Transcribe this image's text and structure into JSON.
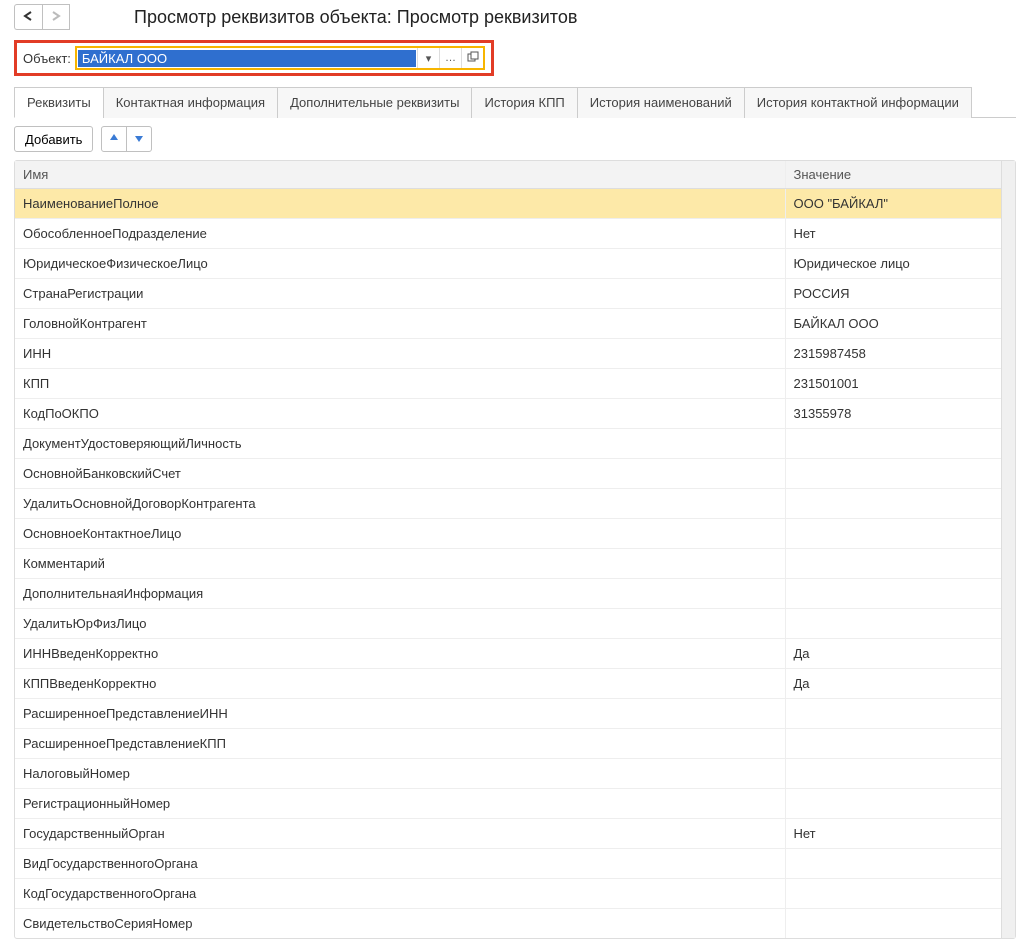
{
  "header": {
    "title": "Просмотр реквизитов объекта: Просмотр реквизитов"
  },
  "object_row": {
    "label": "Объект:",
    "value": "БАЙКАЛ ООО"
  },
  "tabs": [
    {
      "label": "Реквизиты",
      "active": true
    },
    {
      "label": "Контактная информация",
      "active": false
    },
    {
      "label": "Дополнительные реквизиты",
      "active": false
    },
    {
      "label": "История КПП",
      "active": false
    },
    {
      "label": "История наименований",
      "active": false
    },
    {
      "label": "История контактной информации",
      "active": false
    }
  ],
  "toolbar": {
    "add_label": "Добавить"
  },
  "table": {
    "headers": {
      "name": "Имя",
      "value": "Значение"
    },
    "rows": [
      {
        "name": "НаименованиеПолное",
        "value": "ООО \"БАЙКАЛ\"",
        "selected": true
      },
      {
        "name": "ОбособленноеПодразделение",
        "value": "Нет"
      },
      {
        "name": "ЮридическоеФизическоеЛицо",
        "value": "Юридическое лицо"
      },
      {
        "name": "СтранаРегистрации",
        "value": "РОССИЯ"
      },
      {
        "name": "ГоловнойКонтрагент",
        "value": "БАЙКАЛ ООО"
      },
      {
        "name": "ИНН",
        "value": "2315987458"
      },
      {
        "name": "КПП",
        "value": "231501001"
      },
      {
        "name": "КодПоОКПО",
        "value": "31355978"
      },
      {
        "name": "ДокументУдостоверяющийЛичность",
        "value": ""
      },
      {
        "name": "ОсновнойБанковскийСчет",
        "value": ""
      },
      {
        "name": "УдалитьОсновнойДоговорКонтрагента",
        "value": ""
      },
      {
        "name": "ОсновноеКонтактноеЛицо",
        "value": ""
      },
      {
        "name": "Комментарий",
        "value": ""
      },
      {
        "name": "ДополнительнаяИнформация",
        "value": ""
      },
      {
        "name": "УдалитьЮрФизЛицо",
        "value": ""
      },
      {
        "name": "ИННВведенКорректно",
        "value": "Да"
      },
      {
        "name": "КППВведенКорректно",
        "value": "Да"
      },
      {
        "name": "РасширенноеПредставлениеИНН",
        "value": ""
      },
      {
        "name": "РасширенноеПредставлениеКПП",
        "value": ""
      },
      {
        "name": "НалоговыйНомер",
        "value": ""
      },
      {
        "name": "РегистрационныйНомер",
        "value": ""
      },
      {
        "name": "ГосударственныйОрган",
        "value": "Нет"
      },
      {
        "name": "ВидГосударственногоОргана",
        "value": ""
      },
      {
        "name": "КодГосударственногоОргана",
        "value": ""
      },
      {
        "name": "СвидетельствоСерияНомер",
        "value": ""
      }
    ]
  }
}
